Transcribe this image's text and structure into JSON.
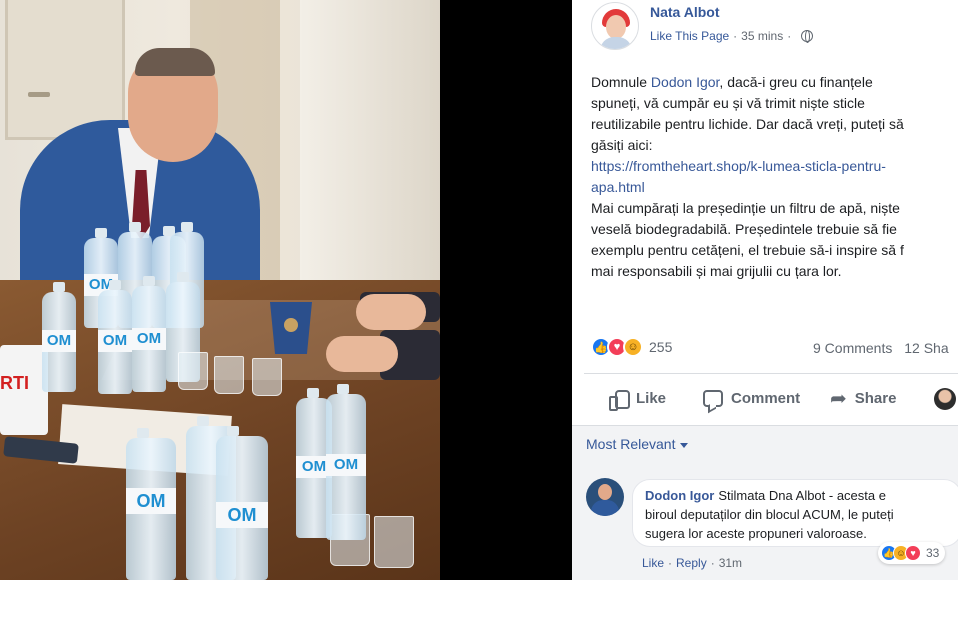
{
  "photo": {
    "bottle_label": "OM",
    "mug_text": "RTI"
  },
  "post": {
    "page_name": "Nata Albot",
    "like_page": "Like This Page",
    "time": "35 mins",
    "text_lines": [
      [
        "Domnule ",
        "Dodon Igor",
        ", dacă-i greu cu finanțele"
      ],
      "spuneți, vă cumpăr eu și vă trimit niște sticle",
      "reutilizabile pentru lichide. Dar dacă vreți, puteți să",
      "găsiți aici:",
      "https://fromtheheart.shop/k-lumea-sticla-pentru-",
      "apa.html",
      "Mai cumpărați la președinție un filtru de apă, niște",
      "veselă biodegradabilă. Președintele trebuie să fie",
      "exemplu pentru cetățeni, el trebuie să-i inspire să f",
      "mai responsabili și mai grijulii cu țara lor."
    ],
    "reaction_count": "255",
    "comments_count": "9 Comments",
    "shares_count": "12 Sha",
    "icons": {
      "globe": "globe-icon",
      "like": "thumbs-up-icon",
      "comment": "comment-bubble-icon",
      "share": "share-arrow-icon"
    },
    "colors": {
      "link": "#385898",
      "like_reaction": "#1877f2",
      "love_reaction": "#f33e58",
      "haha_reaction": "#f7b125"
    }
  },
  "actions": {
    "like": "Like",
    "comment": "Comment",
    "share": "Share"
  },
  "comments": {
    "sort_label": "Most Relevant",
    "items": [
      {
        "author": "Dodon Igor",
        "lines": [
          "Stilmata Dna Albot - acesta e",
          "biroul deputaților din blocul ACUM, le puteți",
          "sugera lor aceste propuneri valoroase."
        ],
        "reaction_count": "33",
        "like": "Like",
        "reply": "Reply",
        "time": "31m"
      }
    ]
  }
}
